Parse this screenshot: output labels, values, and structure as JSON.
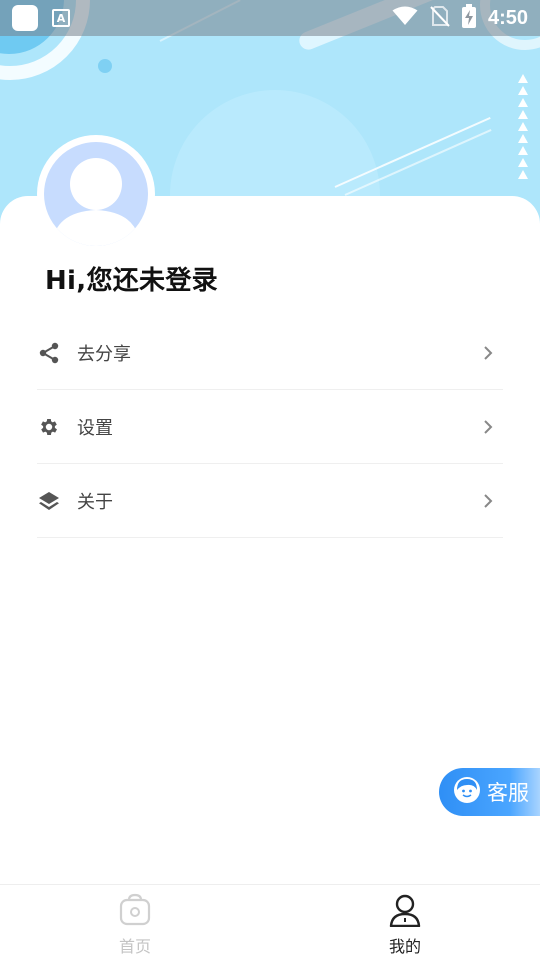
{
  "status_bar": {
    "time": "4:50",
    "left_icons": [
      "app-icon",
      "keyboard-a-icon"
    ],
    "right_icons": [
      "wifi-icon",
      "no-sim-icon",
      "battery-charging-icon"
    ],
    "a_glyph": "A"
  },
  "profile": {
    "greeting": "Hi,您还未登录"
  },
  "menu": {
    "items": [
      {
        "label": "去分享",
        "icon": "share-icon"
      },
      {
        "label": "设置",
        "icon": "gear-icon"
      },
      {
        "label": "关于",
        "icon": "layers-icon"
      }
    ]
  },
  "customer_service": {
    "label": "客服"
  },
  "tabbar": {
    "tabs": [
      {
        "label": "首页",
        "icon": "home-bag-icon",
        "active": false
      },
      {
        "label": "我的",
        "icon": "person-icon",
        "active": true
      }
    ]
  },
  "colors": {
    "hero_bg": "#aee6fb",
    "avatar_bg": "#c7dcfe",
    "accent": "#2f8ff5"
  }
}
